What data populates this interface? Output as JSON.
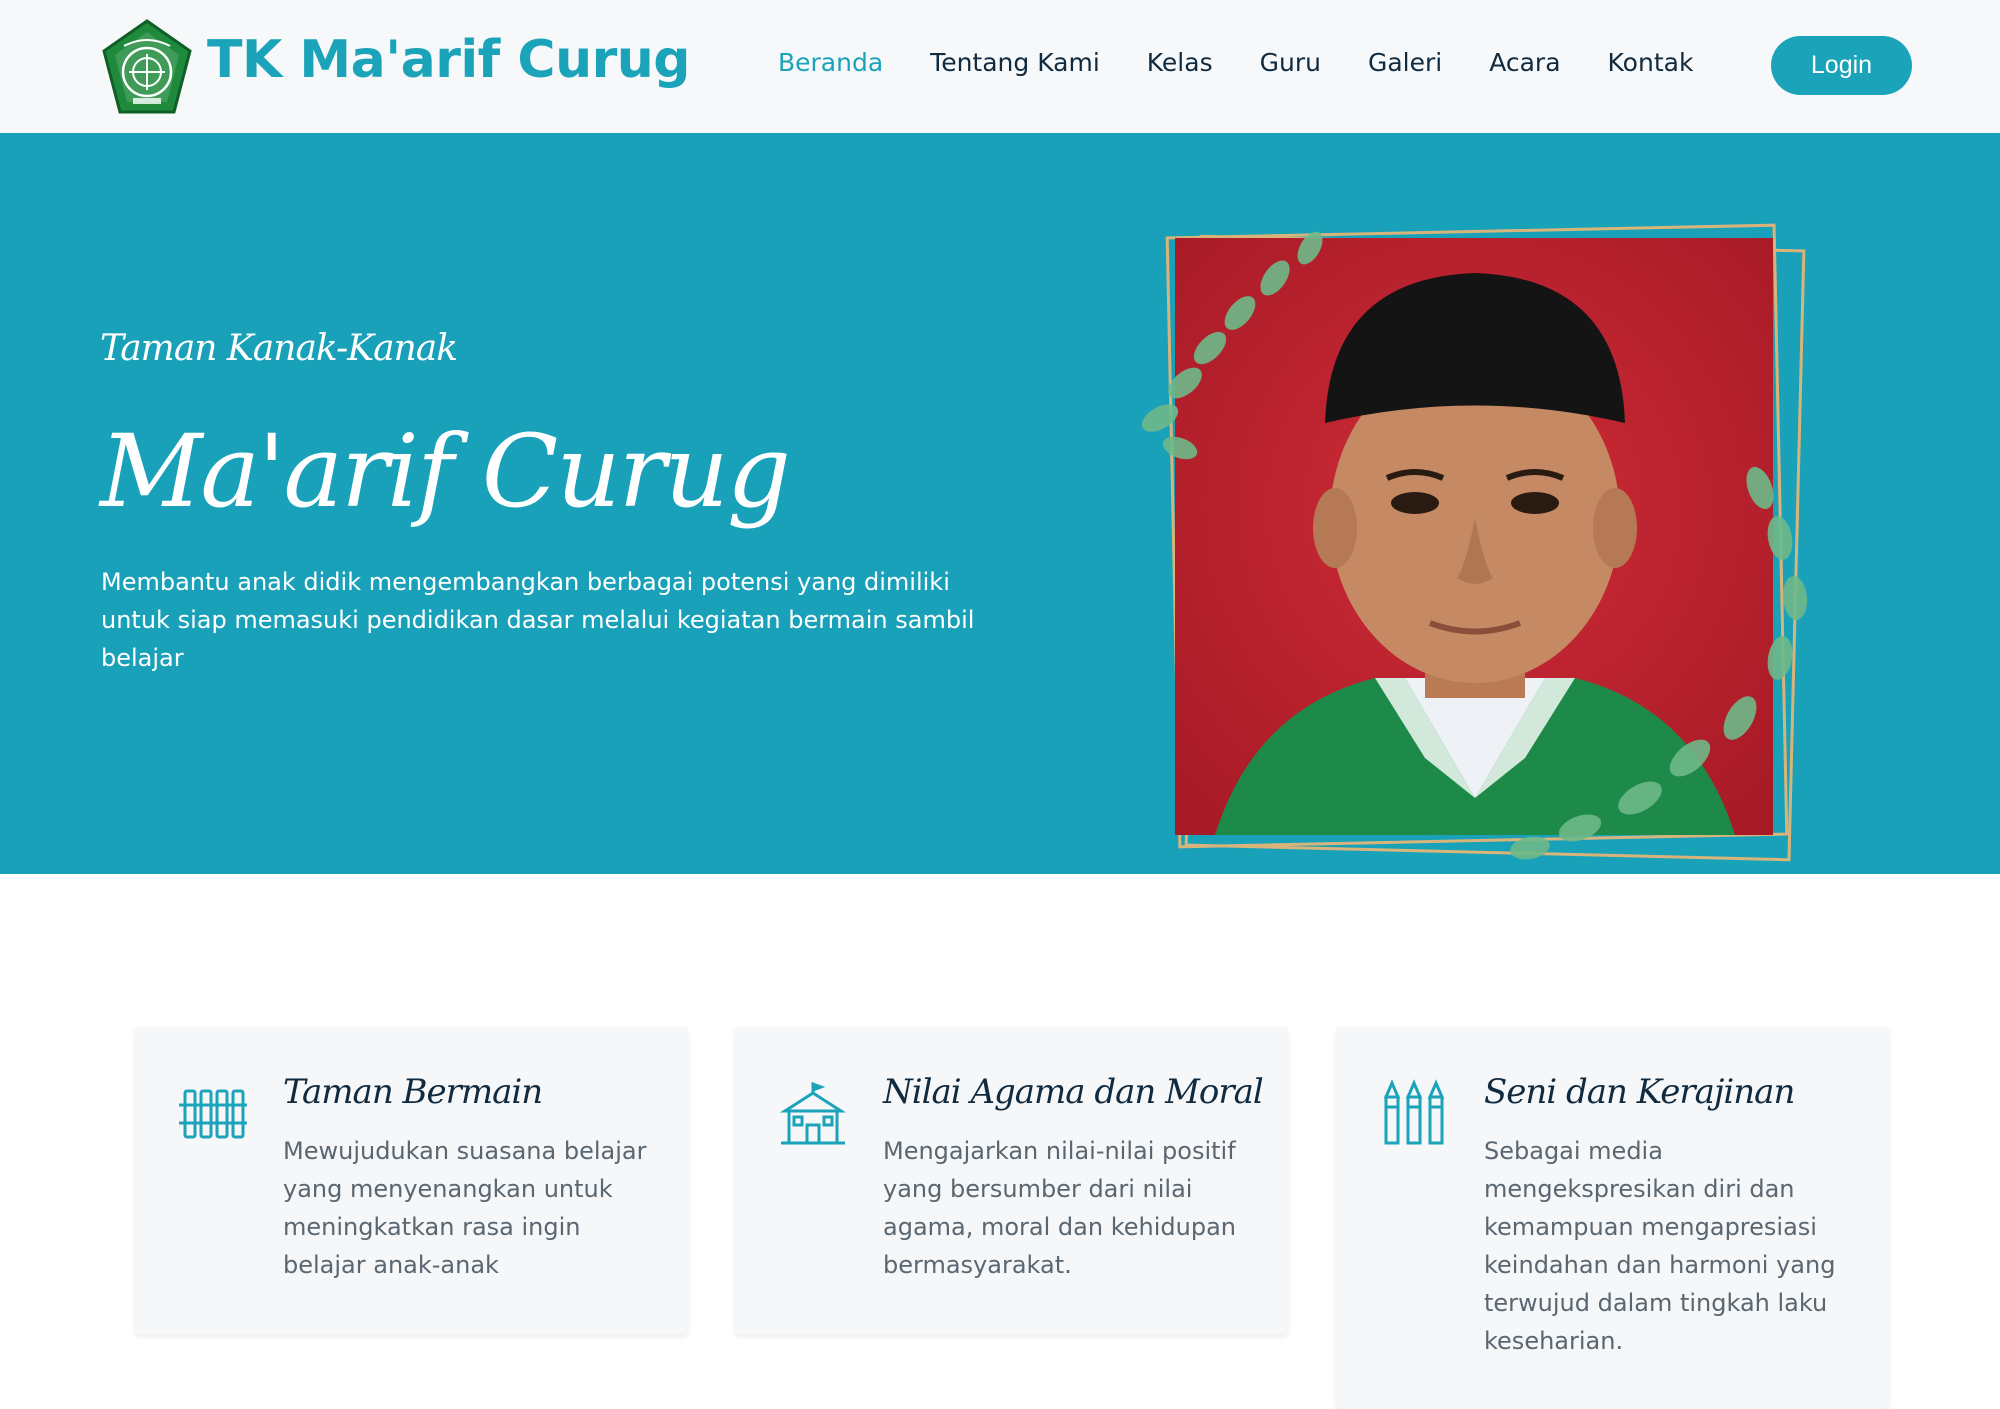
{
  "brand": {
    "name": "TK Ma'arif Curug",
    "logo_icon": "school-emblem-icon",
    "accent_color": "#1aa3b9"
  },
  "nav": {
    "items": [
      {
        "label": "Beranda",
        "active": true
      },
      {
        "label": "Tentang Kami",
        "active": false
      },
      {
        "label": "Kelas",
        "active": false
      },
      {
        "label": "Guru",
        "active": false
      },
      {
        "label": "Galeri",
        "active": false
      },
      {
        "label": "Acara",
        "active": false
      },
      {
        "label": "Kontak",
        "active": false
      }
    ],
    "login_label": "Login"
  },
  "hero": {
    "subtitle": "Taman Kanak-Kanak",
    "title": "Ma'arif Curug",
    "description": "Membantu anak didik mengembangkan berbagai potensi yang dimiliki untuk siap memasuki pendidikan dasar melalui kegiatan bermain sambil belajar",
    "background_color": "#19a1b9",
    "photo_icon": "student-portrait-photo"
  },
  "features": [
    {
      "icon": "playground-fence-icon",
      "title": "Taman Bermain",
      "text": "Mewujudukan suasana belajar yang menyenangkan untuk meningkatkan rasa ingin belajar anak-anak"
    },
    {
      "icon": "school-building-icon",
      "title": "Nilai Agama dan Moral",
      "text": "Mengajarkan nilai-nilai positif yang bersumber dari nilai agama, moral dan kehidupan bermasyarakat."
    },
    {
      "icon": "crayons-icon",
      "title": "Seni dan Kerajinan",
      "text": "Sebagai media mengekspresikan diri dan kemampuan mengapresiasi keindahan dan harmoni yang terwujud dalam tingkah laku keseharian."
    }
  ]
}
